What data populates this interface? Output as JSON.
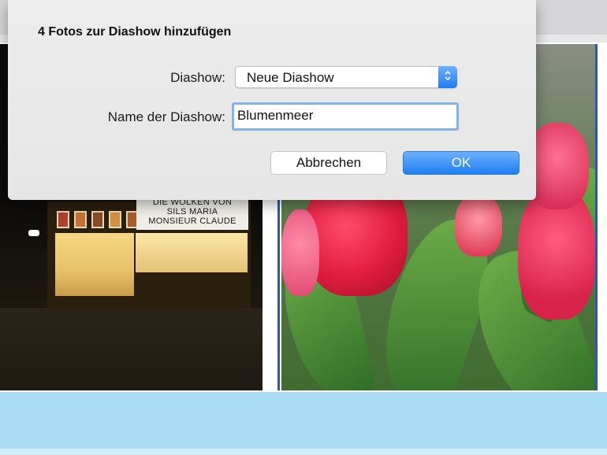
{
  "dialog": {
    "title": "4 Fotos zur Diashow hinzufügen",
    "slideshow_label": "Diashow:",
    "slideshow_selected": "Neue Diashow",
    "name_label": "Name der Diashow:",
    "name_value": "Blumenmeer",
    "cancel_label": "Abbrechen",
    "ok_label": "OK"
  },
  "photos": {
    "cinema_marquee": [
      "DIE WOLKEN VON",
      "SILS  MARIA",
      "MONSIEUR CLAUDE"
    ]
  },
  "colors": {
    "accent": "#1f7ef2",
    "background": "#a9dcf3",
    "selection_border": "#2c5aa0"
  },
  "icons": {
    "select_arrows": "updown-chevron-icon"
  }
}
